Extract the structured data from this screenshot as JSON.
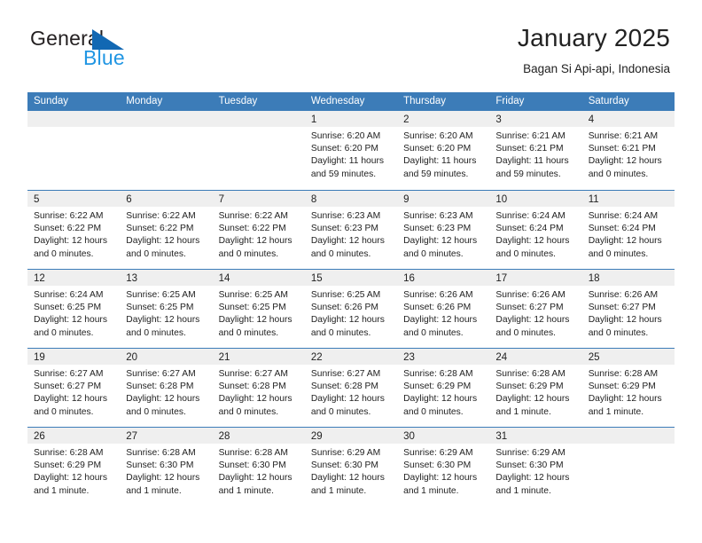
{
  "logo": {
    "text_top": "General",
    "text_bottom": "Blue",
    "triangle_color": "#1268b3",
    "blue_color": "#2196e3"
  },
  "header": {
    "title": "January 2025",
    "subtitle": "Bagan Si Api-api, Indonesia"
  },
  "theme": {
    "header_blue": "#3c7cb8",
    "band_gray": "#efefef"
  },
  "weekdays": [
    "Sunday",
    "Monday",
    "Tuesday",
    "Wednesday",
    "Thursday",
    "Friday",
    "Saturday"
  ],
  "weeks": [
    [
      {
        "day": "",
        "sunrise": "",
        "sunset": "",
        "daylight1": "",
        "daylight2": ""
      },
      {
        "day": "",
        "sunrise": "",
        "sunset": "",
        "daylight1": "",
        "daylight2": ""
      },
      {
        "day": "",
        "sunrise": "",
        "sunset": "",
        "daylight1": "",
        "daylight2": ""
      },
      {
        "day": "1",
        "sunrise": "Sunrise: 6:20 AM",
        "sunset": "Sunset: 6:20 PM",
        "daylight1": "Daylight: 11 hours",
        "daylight2": "and 59 minutes."
      },
      {
        "day": "2",
        "sunrise": "Sunrise: 6:20 AM",
        "sunset": "Sunset: 6:20 PM",
        "daylight1": "Daylight: 11 hours",
        "daylight2": "and 59 minutes."
      },
      {
        "day": "3",
        "sunrise": "Sunrise: 6:21 AM",
        "sunset": "Sunset: 6:21 PM",
        "daylight1": "Daylight: 11 hours",
        "daylight2": "and 59 minutes."
      },
      {
        "day": "4",
        "sunrise": "Sunrise: 6:21 AM",
        "sunset": "Sunset: 6:21 PM",
        "daylight1": "Daylight: 12 hours",
        "daylight2": "and 0 minutes."
      }
    ],
    [
      {
        "day": "5",
        "sunrise": "Sunrise: 6:22 AM",
        "sunset": "Sunset: 6:22 PM",
        "daylight1": "Daylight: 12 hours",
        "daylight2": "and 0 minutes."
      },
      {
        "day": "6",
        "sunrise": "Sunrise: 6:22 AM",
        "sunset": "Sunset: 6:22 PM",
        "daylight1": "Daylight: 12 hours",
        "daylight2": "and 0 minutes."
      },
      {
        "day": "7",
        "sunrise": "Sunrise: 6:22 AM",
        "sunset": "Sunset: 6:22 PM",
        "daylight1": "Daylight: 12 hours",
        "daylight2": "and 0 minutes."
      },
      {
        "day": "8",
        "sunrise": "Sunrise: 6:23 AM",
        "sunset": "Sunset: 6:23 PM",
        "daylight1": "Daylight: 12 hours",
        "daylight2": "and 0 minutes."
      },
      {
        "day": "9",
        "sunrise": "Sunrise: 6:23 AM",
        "sunset": "Sunset: 6:23 PM",
        "daylight1": "Daylight: 12 hours",
        "daylight2": "and 0 minutes."
      },
      {
        "day": "10",
        "sunrise": "Sunrise: 6:24 AM",
        "sunset": "Sunset: 6:24 PM",
        "daylight1": "Daylight: 12 hours",
        "daylight2": "and 0 minutes."
      },
      {
        "day": "11",
        "sunrise": "Sunrise: 6:24 AM",
        "sunset": "Sunset: 6:24 PM",
        "daylight1": "Daylight: 12 hours",
        "daylight2": "and 0 minutes."
      }
    ],
    [
      {
        "day": "12",
        "sunrise": "Sunrise: 6:24 AM",
        "sunset": "Sunset: 6:25 PM",
        "daylight1": "Daylight: 12 hours",
        "daylight2": "and 0 minutes."
      },
      {
        "day": "13",
        "sunrise": "Sunrise: 6:25 AM",
        "sunset": "Sunset: 6:25 PM",
        "daylight1": "Daylight: 12 hours",
        "daylight2": "and 0 minutes."
      },
      {
        "day": "14",
        "sunrise": "Sunrise: 6:25 AM",
        "sunset": "Sunset: 6:25 PM",
        "daylight1": "Daylight: 12 hours",
        "daylight2": "and 0 minutes."
      },
      {
        "day": "15",
        "sunrise": "Sunrise: 6:25 AM",
        "sunset": "Sunset: 6:26 PM",
        "daylight1": "Daylight: 12 hours",
        "daylight2": "and 0 minutes."
      },
      {
        "day": "16",
        "sunrise": "Sunrise: 6:26 AM",
        "sunset": "Sunset: 6:26 PM",
        "daylight1": "Daylight: 12 hours",
        "daylight2": "and 0 minutes."
      },
      {
        "day": "17",
        "sunrise": "Sunrise: 6:26 AM",
        "sunset": "Sunset: 6:27 PM",
        "daylight1": "Daylight: 12 hours",
        "daylight2": "and 0 minutes."
      },
      {
        "day": "18",
        "sunrise": "Sunrise: 6:26 AM",
        "sunset": "Sunset: 6:27 PM",
        "daylight1": "Daylight: 12 hours",
        "daylight2": "and 0 minutes."
      }
    ],
    [
      {
        "day": "19",
        "sunrise": "Sunrise: 6:27 AM",
        "sunset": "Sunset: 6:27 PM",
        "daylight1": "Daylight: 12 hours",
        "daylight2": "and 0 minutes."
      },
      {
        "day": "20",
        "sunrise": "Sunrise: 6:27 AM",
        "sunset": "Sunset: 6:28 PM",
        "daylight1": "Daylight: 12 hours",
        "daylight2": "and 0 minutes."
      },
      {
        "day": "21",
        "sunrise": "Sunrise: 6:27 AM",
        "sunset": "Sunset: 6:28 PM",
        "daylight1": "Daylight: 12 hours",
        "daylight2": "and 0 minutes."
      },
      {
        "day": "22",
        "sunrise": "Sunrise: 6:27 AM",
        "sunset": "Sunset: 6:28 PM",
        "daylight1": "Daylight: 12 hours",
        "daylight2": "and 0 minutes."
      },
      {
        "day": "23",
        "sunrise": "Sunrise: 6:28 AM",
        "sunset": "Sunset: 6:29 PM",
        "daylight1": "Daylight: 12 hours",
        "daylight2": "and 0 minutes."
      },
      {
        "day": "24",
        "sunrise": "Sunrise: 6:28 AM",
        "sunset": "Sunset: 6:29 PM",
        "daylight1": "Daylight: 12 hours",
        "daylight2": "and 1 minute."
      },
      {
        "day": "25",
        "sunrise": "Sunrise: 6:28 AM",
        "sunset": "Sunset: 6:29 PM",
        "daylight1": "Daylight: 12 hours",
        "daylight2": "and 1 minute."
      }
    ],
    [
      {
        "day": "26",
        "sunrise": "Sunrise: 6:28 AM",
        "sunset": "Sunset: 6:29 PM",
        "daylight1": "Daylight: 12 hours",
        "daylight2": "and 1 minute."
      },
      {
        "day": "27",
        "sunrise": "Sunrise: 6:28 AM",
        "sunset": "Sunset: 6:30 PM",
        "daylight1": "Daylight: 12 hours",
        "daylight2": "and 1 minute."
      },
      {
        "day": "28",
        "sunrise": "Sunrise: 6:28 AM",
        "sunset": "Sunset: 6:30 PM",
        "daylight1": "Daylight: 12 hours",
        "daylight2": "and 1 minute."
      },
      {
        "day": "29",
        "sunrise": "Sunrise: 6:29 AM",
        "sunset": "Sunset: 6:30 PM",
        "daylight1": "Daylight: 12 hours",
        "daylight2": "and 1 minute."
      },
      {
        "day": "30",
        "sunrise": "Sunrise: 6:29 AM",
        "sunset": "Sunset: 6:30 PM",
        "daylight1": "Daylight: 12 hours",
        "daylight2": "and 1 minute."
      },
      {
        "day": "31",
        "sunrise": "Sunrise: 6:29 AM",
        "sunset": "Sunset: 6:30 PM",
        "daylight1": "Daylight: 12 hours",
        "daylight2": "and 1 minute."
      },
      {
        "day": "",
        "sunrise": "",
        "sunset": "",
        "daylight1": "",
        "daylight2": ""
      }
    ]
  ]
}
